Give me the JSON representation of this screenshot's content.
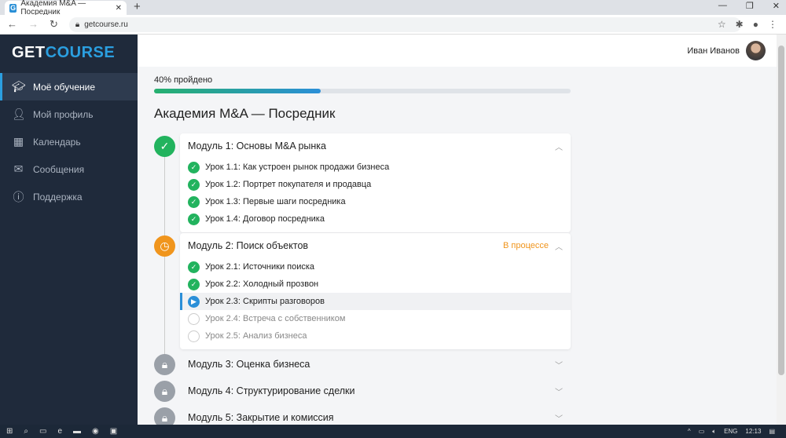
{
  "browser": {
    "tab_title": "Академия M&A — Посредник",
    "favicon": "G",
    "url": "getcourse.ru"
  },
  "sidebar": {
    "logo_a": "GET",
    "logo_b": "COURSE",
    "items": [
      {
        "label": "Моё обучение",
        "icon": "graduation-cap-icon",
        "active": true
      },
      {
        "label": "Мой профиль",
        "icon": "user-icon"
      },
      {
        "label": "Календарь",
        "icon": "calendar-icon"
      },
      {
        "label": "Сообщения",
        "icon": "mail-icon"
      },
      {
        "label": "Поддержка",
        "icon": "help-icon"
      }
    ]
  },
  "header": {
    "user_name": "Иван Иванов"
  },
  "progress": {
    "label": "40% пройдено",
    "percent": 40
  },
  "course_title": "Академия M&A — Посредник",
  "modules": [
    {
      "title": "Модуль 1: Основы M&A рынка",
      "state": "done",
      "lessons": [
        {
          "title": "Урок 1.1: Как устроен рынок продажи бизнеса",
          "state": "done"
        },
        {
          "title": "Урок 1.2: Портрет покупателя и продавца",
          "state": "done"
        },
        {
          "title": "Урок 1.3: Первые шаги посредника",
          "state": "done"
        },
        {
          "title": "Урок 1.4: Договор посредника",
          "state": "done"
        }
      ]
    },
    {
      "title": "Модуль 2: Поиск объектов",
      "state": "in-progress",
      "status": "В процессе",
      "lessons": [
        {
          "title": "Урок 2.1: Источники поиска",
          "state": "done"
        },
        {
          "title": "Урок 2.2: Холодный прозвон",
          "state": "done"
        },
        {
          "title": "Урок 2.3: Скрипты разговоров",
          "state": "current"
        },
        {
          "title": "Урок 2.4: Встреча с собственником",
          "state": "todo"
        },
        {
          "title": "Урок 2.5: Анализ бизнеса",
          "state": "todo"
        }
      ]
    },
    {
      "title": "Модуль 3: Оценка бизнеса",
      "state": "locked"
    },
    {
      "title": "Модуль 4: Структурирование сделки",
      "state": "locked"
    },
    {
      "title": "Модуль 5: Закрытие и комиссия",
      "state": "locked"
    }
  ],
  "taskbar": {
    "lang": "ENG",
    "time": "12:13"
  },
  "colors": {
    "sidebar": "#1f2a3b",
    "accent": "#2b9fe0",
    "done": "#22b35e",
    "in_progress": "#f0951d",
    "locked": "#9aa0a8"
  }
}
